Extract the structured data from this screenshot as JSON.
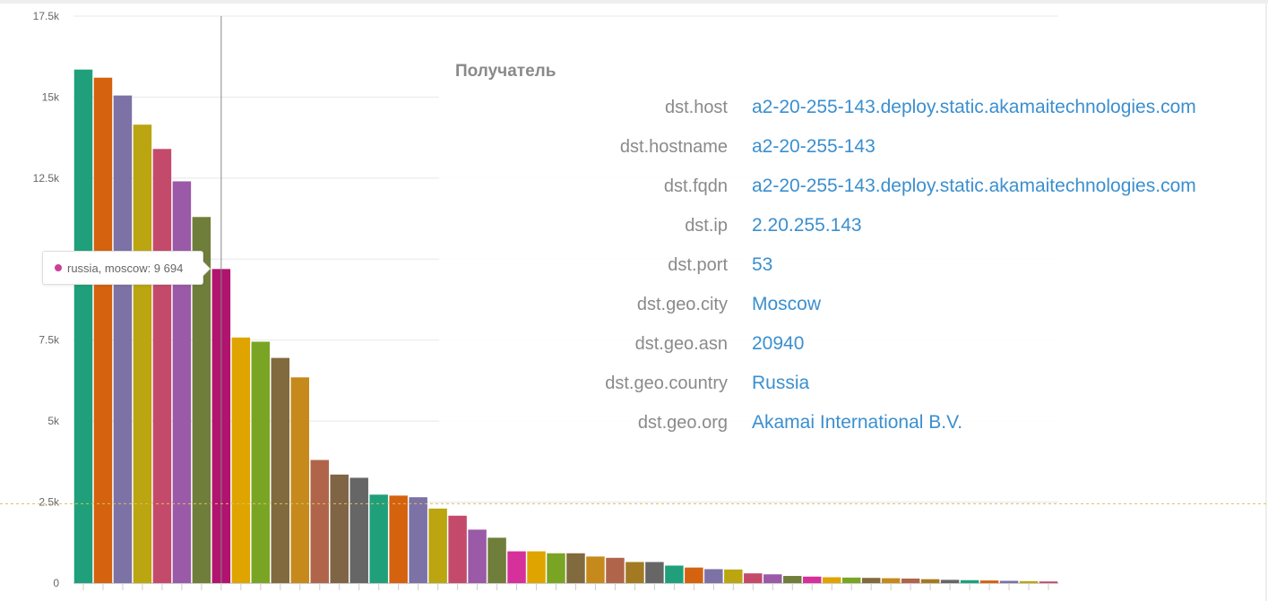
{
  "chart_data": {
    "type": "bar",
    "ylim": [
      0,
      17500
    ],
    "yticks": [
      0,
      2500,
      5000,
      7500,
      10000,
      12500,
      15000,
      17500
    ],
    "ytick_labels": [
      "0",
      "2.5k",
      "5k",
      "7.5k",
      "",
      "12.5k",
      "15k",
      "17.5k"
    ],
    "threshold_line": 2450,
    "crosshair_index": 7,
    "grid": true,
    "values": [
      15850,
      15600,
      15050,
      14150,
      13400,
      12400,
      11300,
      9694,
      7580,
      7450,
      6950,
      6350,
      3800,
      3350,
      3250,
      2730,
      2700,
      2650,
      2300,
      2080,
      1650,
      1400,
      980,
      980,
      920,
      920,
      820,
      780,
      650,
      650,
      540,
      480,
      430,
      420,
      300,
      270,
      220,
      200,
      180,
      170,
      160,
      150,
      140,
      120,
      100,
      90,
      80,
      70,
      60,
      50
    ],
    "colors": [
      "#1fa07b",
      "#d4620f",
      "#7c72a6",
      "#bba510",
      "#c44a6c",
      "#9a5aa8",
      "#6f7e3a",
      "#b0146e",
      "#e0a400",
      "#7aa524",
      "#816a3e",
      "#c68a1c",
      "#b0654a",
      "#806446",
      "#666666",
      "#1fa07b",
      "#d4620f",
      "#7c72a6",
      "#bba510",
      "#c44a6c",
      "#9a5aa8",
      "#6f7e3a",
      "#d6309a",
      "#e0a400",
      "#7aa524",
      "#816a3e",
      "#c68a1c",
      "#b0654a",
      "#a37a22",
      "#666666",
      "#1fa07b",
      "#d4620f",
      "#7c72a6",
      "#bba510",
      "#c44a6c",
      "#9a5aa8",
      "#6f7e3a",
      "#d6309a",
      "#e0a400",
      "#7aa524",
      "#816a3e",
      "#c68a1c",
      "#b0654a",
      "#a37a22",
      "#666666",
      "#1fa07b",
      "#d4620f",
      "#7c72a6",
      "#bba510",
      "#c44a6c"
    ]
  },
  "tooltip": {
    "text": "russia, moscow: 9 694",
    "dot_color": "#cc3f97"
  },
  "info_panel": {
    "title": "Получатель",
    "rows": [
      {
        "key": "dst.host",
        "value": "a2-20-255-143.deploy.static.akamaitechnologies.com"
      },
      {
        "key": "dst.hostname",
        "value": "a2-20-255-143"
      },
      {
        "key": "dst.fqdn",
        "value": "a2-20-255-143.deploy.static.akamaitechnologies.com"
      },
      {
        "key": "dst.ip",
        "value": "2.20.255.143"
      },
      {
        "key": "dst.port",
        "value": "53"
      },
      {
        "key": "dst.geo.city",
        "value": "Moscow"
      },
      {
        "key": "dst.geo.asn",
        "value": "20940"
      },
      {
        "key": "dst.geo.country",
        "value": "Russia"
      },
      {
        "key": "dst.geo.org",
        "value": "Akamai International B.V."
      }
    ]
  },
  "colors": {
    "link": "#3b8fcf",
    "key_text": "#8a8a8a",
    "grid": "#e8e8e8",
    "threshold": "#d8c060"
  }
}
